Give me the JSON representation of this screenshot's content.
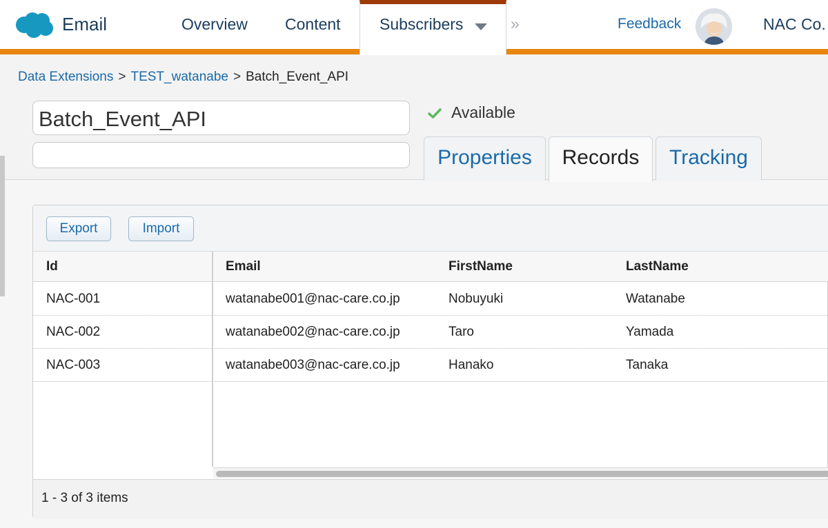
{
  "topnav": {
    "app_name": "Email",
    "items": [
      {
        "label": "Overview"
      },
      {
        "label": "Content"
      },
      {
        "label": "Subscribers"
      }
    ],
    "more_glyph": "»",
    "feedback_label": "Feedback",
    "org_name": "NAC Co.",
    "accent_color": "#e8850f",
    "active_tab_color": "#9e3a07",
    "icons": {
      "logo": "salesforce-cloud-logo",
      "dropdown": "caret-down-icon",
      "avatar": "einstein-avatar"
    }
  },
  "breadcrumb": {
    "items": [
      "Data Extensions",
      "TEST_watanabe",
      "Batch_Event_API"
    ],
    "separator": ">"
  },
  "data_extension": {
    "name": "Batch_Event_API",
    "description": "",
    "status": "Available",
    "status_color": "#5cb85c"
  },
  "tabs": [
    {
      "label": "Properties",
      "active": false
    },
    {
      "label": "Records",
      "active": true
    },
    {
      "label": "Tracking",
      "active": false
    }
  ],
  "records": {
    "toolbar": {
      "export_label": "Export",
      "import_label": "Import"
    },
    "columns": [
      "Id",
      "Email",
      "FirstName",
      "LastName"
    ],
    "rows": [
      [
        "NAC-001",
        "watanabe001@nac-care.co.jp",
        "Nobuyuki",
        "Watanabe"
      ],
      [
        "NAC-002",
        "watanabe002@nac-care.co.jp",
        "Taro",
        "Yamada"
      ],
      [
        "NAC-003",
        "watanabe003@nac-care.co.jp",
        "Hanako",
        "Tanaka"
      ]
    ],
    "pager_text": "1 - 3 of 3 items"
  }
}
